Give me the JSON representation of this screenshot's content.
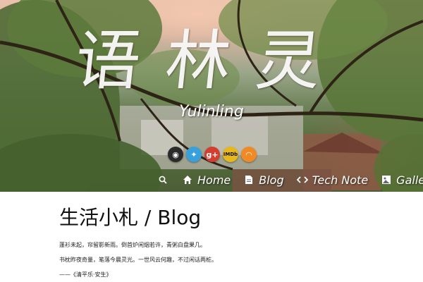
{
  "hero": {
    "title": "语林灵",
    "subtitle": "Yulinling"
  },
  "social": [
    {
      "name": "github",
      "icon": "github-icon",
      "glyph": "◉"
    },
    {
      "name": "twitter",
      "icon": "twitter-icon",
      "glyph": "✦"
    },
    {
      "name": "google-plus",
      "icon": "google-plus-icon",
      "glyph": "g+"
    },
    {
      "name": "imdb",
      "icon": "imdb-icon",
      "glyph": "IMDb"
    },
    {
      "name": "rss",
      "icon": "rss-icon",
      "glyph": "◠"
    }
  ],
  "nav": {
    "search_icon": "search-icon",
    "items": [
      {
        "label": "Home",
        "icon": "home-icon"
      },
      {
        "label": "Blog",
        "icon": "document-icon"
      },
      {
        "label": "Tech Note",
        "icon": "code-icon"
      },
      {
        "label": "Gallery",
        "icon": "image-icon"
      }
    ]
  },
  "content": {
    "title": "生活小札 / Blog",
    "paragraphs": [
      "蓬衫未起，帘留影新雨。倒首炉闲烟若许，青粥白盘果几。",
      "书枕昨夜奇量，笔落今晨灵光。一世风云何趣，不过闲话两桩。",
      "——《清平乐·安生》"
    ]
  },
  "colors": {
    "text": "#111111",
    "twitter": "#38a1db",
    "gplus": "#d23f31",
    "imdb": "#e7b81c",
    "rss": "#f08a24"
  }
}
